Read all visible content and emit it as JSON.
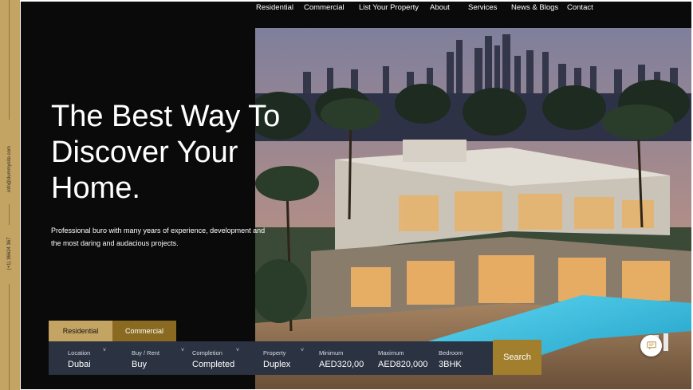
{
  "colors": {
    "gold": "#c4a463",
    "dark_gold": "#8a6a21",
    "search_bg": "#2b3241",
    "hero_bg": "#0b0a0a"
  },
  "rail": {
    "email": "info@dummysite.com",
    "phone": "(+1) 36624 367"
  },
  "nav": [
    "Residential",
    "Commercial",
    "List Your Property",
    "About",
    "Services",
    "News & Blogs",
    "Contact"
  ],
  "hero": {
    "headline": [
      "The Best Way To",
      "Discover Your",
      "Home."
    ],
    "subtext": [
      "Professional buro with many years of experience, development and",
      "the most daring and audacious projects."
    ]
  },
  "tabs": [
    "Residential",
    "Commercial"
  ],
  "search": {
    "fields": [
      {
        "label": "Location",
        "value": "Dubai"
      },
      {
        "label": "Buy / Rent",
        "value": "Buy"
      },
      {
        "label": "Completion",
        "value": "Completed"
      },
      {
        "label": "Property",
        "value": "Duplex"
      },
      {
        "label": "Minimum",
        "value": "AED320,00"
      },
      {
        "label": "Maximum",
        "value": "AED820,000"
      },
      {
        "label": "Bedroom",
        "value": "3BHK"
      }
    ],
    "chevron": "˅",
    "button": "Search"
  },
  "icons": {
    "chat": "chat-bubble-icon"
  }
}
